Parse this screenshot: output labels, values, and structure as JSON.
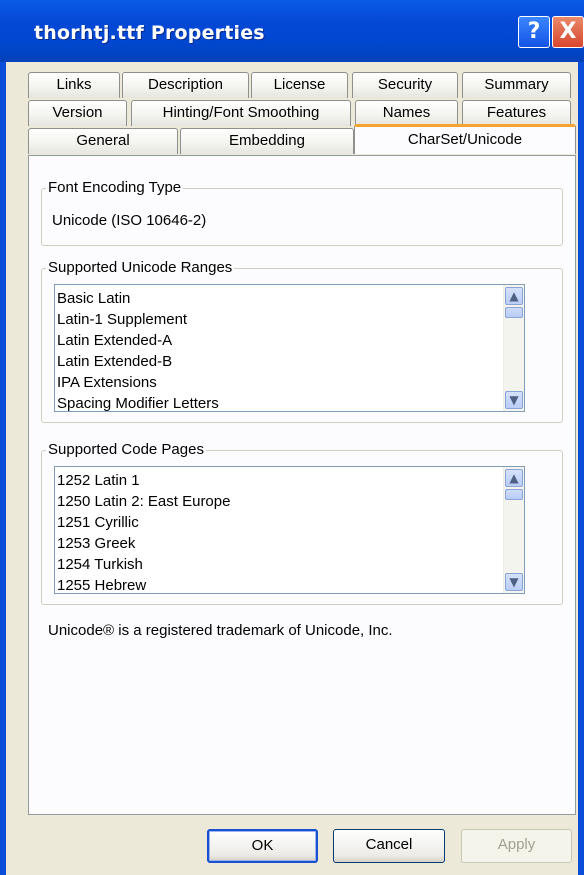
{
  "window": {
    "title": "thorhtj.ttf Properties",
    "help_label": "?",
    "close_label": "X"
  },
  "tabs": {
    "row1": [
      "Links",
      "Description",
      "License",
      "Security",
      "Summary"
    ],
    "row2": [
      "Version",
      "Hinting/Font Smoothing",
      "Names",
      "Features"
    ],
    "row3": [
      "General",
      "Embedding",
      "CharSet/Unicode"
    ],
    "active": "CharSet/Unicode"
  },
  "encoding": {
    "legend": "Font Encoding Type",
    "value": "Unicode (ISO 10646-2)"
  },
  "ranges": {
    "legend": "Supported Unicode Ranges",
    "items": [
      "Basic Latin",
      "Latin-1 Supplement",
      "Latin Extended-A",
      "Latin Extended-B",
      "IPA Extensions",
      "Spacing Modifier Letters"
    ]
  },
  "codepages": {
    "legend": "Supported Code Pages",
    "items": [
      "1252  Latin 1",
      "1250  Latin 2: East Europe",
      "1251  Cyrillic",
      "1253  Greek",
      "1254  Turkish",
      "1255  Hebrew"
    ]
  },
  "trademark": "Unicode® is a registered trademark of Unicode, Inc.",
  "buttons": {
    "ok": "OK",
    "cancel": "Cancel",
    "apply": "Apply"
  },
  "icons": {
    "scroll_up": "scroll-up-arrow-icon",
    "scroll_down": "scroll-down-arrow-icon"
  }
}
